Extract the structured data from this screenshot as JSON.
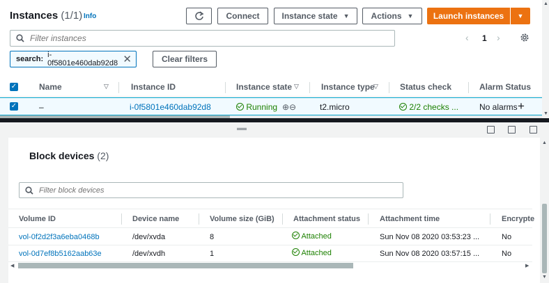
{
  "header": {
    "title": "Instances",
    "count": "(1/1)",
    "info_label": "Info",
    "refresh_icon": "refresh-icon",
    "connect_label": "Connect",
    "instance_state_label": "Instance state",
    "actions_label": "Actions",
    "launch_label": "Launch instances"
  },
  "filter": {
    "placeholder": "Filter instances",
    "token_key": "search:",
    "token_value": "i-0f5801e460dab92d8",
    "clear_label": "Clear filters"
  },
  "pagination": {
    "prev": "‹",
    "page": "1",
    "next": "›"
  },
  "instances_table": {
    "columns": [
      "Name",
      "Instance ID",
      "Instance state",
      "Instance type",
      "Status check",
      "Alarm Status"
    ],
    "rows": [
      {
        "name": "–",
        "instance_id": "i-0f5801e460dab92d8",
        "state": "Running",
        "type": "t2.micro",
        "status_check": "2/2 checks ...",
        "alarm_status": "No alarms",
        "add_alarm": "+"
      }
    ]
  },
  "block_devices": {
    "title": "Block devices",
    "count": "(2)",
    "search_placeholder": "Filter block devices",
    "columns": [
      "Volume ID",
      "Device name",
      "Volume size (GiB)",
      "Attachment status",
      "Attachment time",
      "Encrypte"
    ],
    "rows": [
      {
        "volume_id": "vol-0f2d2f3a6eba0468b",
        "device": "/dev/xvda",
        "size": "8",
        "status": "Attached",
        "time": "Sun Nov 08 2020 03:53:23 ...",
        "encrypted": "No"
      },
      {
        "volume_id": "vol-0d7ef8b5162aab63e",
        "device": "/dev/xvdh",
        "size": "1",
        "status": "Attached",
        "time": "Sun Nov 08 2020 03:57:15 ...",
        "encrypted": "No"
      }
    ]
  },
  "colors": {
    "primary": "#ec7211",
    "link": "#0073bb",
    "success": "#1d8102"
  }
}
